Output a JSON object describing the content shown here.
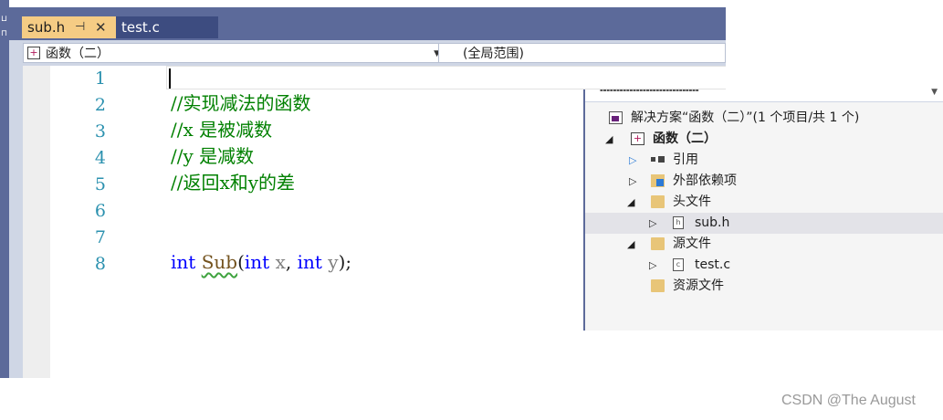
{
  "tabs": [
    {
      "label": "sub.h",
      "active": true,
      "pin_icon": "pin-icon",
      "close_icon": "close-icon"
    },
    {
      "label": "test.c",
      "active": false
    }
  ],
  "navbar": {
    "project_scope": "函数（二）",
    "global_scope": "(全局范围)"
  },
  "editor": {
    "line_numbers": [
      "1",
      "2",
      "3",
      "4",
      "5",
      "6",
      "7",
      "8"
    ],
    "lines": {
      "l2": "//实现减法的函数",
      "l3": "//x 是被减数",
      "l4": "//y 是减数",
      "l5": "//返回x和y的差",
      "l8": {
        "kw1": "int",
        "fn": "Sub",
        "open": "(",
        "kw2": "int",
        "p1": "x",
        "comma": ", ",
        "kw3": "int",
        "p2": "y",
        "close": ");"
      }
    }
  },
  "solution_explorer": {
    "items": [
      {
        "label": "解决方案“函数（二）”(1 个项目/共 1 个)",
        "icon": "solution-icon",
        "bold": false
      },
      {
        "label": "函数（二）",
        "icon": "project-icon",
        "bold": true,
        "expanded": true
      },
      {
        "label": "引用",
        "icon": "references-icon",
        "expanded": false
      },
      {
        "label": "外部依赖项",
        "icon": "external-deps-icon",
        "expanded": false
      },
      {
        "label": "头文件",
        "icon": "folder-icon",
        "expanded": true
      },
      {
        "label": "sub.h",
        "icon": "header-file-icon",
        "selected": true
      },
      {
        "label": "源文件",
        "icon": "folder-icon",
        "expanded": true
      },
      {
        "label": "test.c",
        "icon": "c-file-icon"
      },
      {
        "label": "资源文件",
        "icon": "folder-icon"
      }
    ]
  },
  "watermark": "CSDN @The    August",
  "colors": {
    "tab_active": "#f5cc84",
    "chrome": "#5c6a9a",
    "keyword": "#0000ff",
    "comment": "#008000",
    "line_number": "#2b91af"
  }
}
